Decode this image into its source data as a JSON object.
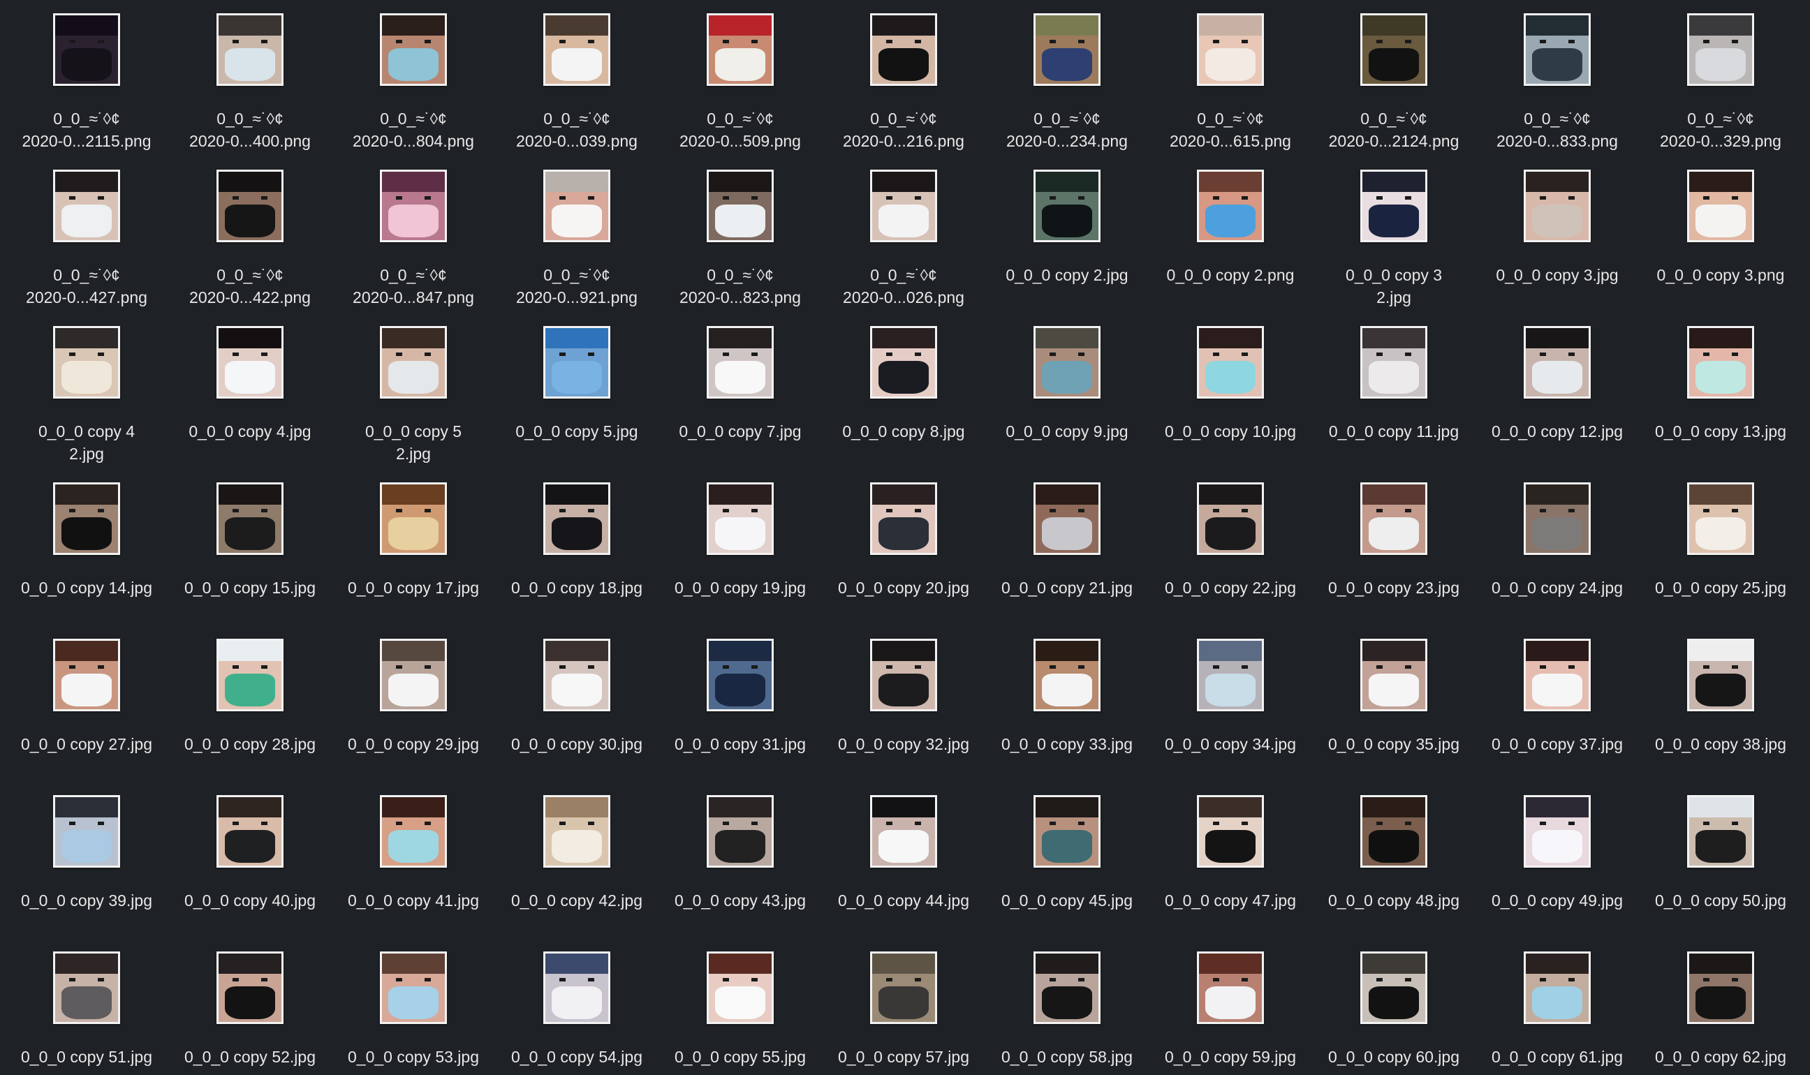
{
  "files": [
    {
      "name": "0_0_≈˙◊¢\n2020-0...2115.png",
      "skin": "#2b2230",
      "hair": "#120d18",
      "mask": "#15121a"
    },
    {
      "name": "0_0_≈˙◊¢\n2020-0...400.png",
      "skin": "#c9b7aa",
      "hair": "#3a3533",
      "mask": "#d9e3ea"
    },
    {
      "name": "0_0_≈˙◊¢\n2020-0...804.png",
      "skin": "#b88670",
      "hair": "#2a1f1b",
      "mask": "#8fc3d6"
    },
    {
      "name": "0_0_≈˙◊¢\n2020-0...039.png",
      "skin": "#d8b9a0",
      "hair": "#4a3b31",
      "mask": "#f4f4f4"
    },
    {
      "name": "0_0_≈˙◊¢\n2020-0...509.png",
      "skin": "#c98a72",
      "hair": "#b8242a",
      "mask": "#f0efe9"
    },
    {
      "name": "0_0_≈˙◊¢\n2020-0...216.png",
      "skin": "#d3b6a4",
      "hair": "#1e1a1b",
      "mask": "#121212"
    },
    {
      "name": "0_0_≈˙◊¢\n2020-0...234.png",
      "skin": "#9c7b5c",
      "hair": "#7b7b52",
      "mask": "#2e3f72"
    },
    {
      "name": "0_0_≈˙◊¢\n2020-0...615.png",
      "skin": "#e8c7b6",
      "hair": "#c8b1a4",
      "mask": "#f3eae4"
    },
    {
      "name": "0_0_≈˙◊¢\n2020-0...2124.png",
      "skin": "#6a5a3e",
      "hair": "#3e3a26",
      "mask": "#121212"
    },
    {
      "name": "0_0_≈˙◊¢\n2020-0...833.png",
      "skin": "#9aa8b2",
      "hair": "#222c33",
      "mask": "#2f3b45"
    },
    {
      "name": "0_0_≈˙◊¢\n2020-0...329.png",
      "skin": "#b9b6b5",
      "hair": "#3a3a3c",
      "mask": "#d8dadd"
    },
    {
      "name": "0_0_≈˙◊¢\n2020-0...427.png",
      "skin": "#d8c2b6",
      "hair": "#201b1c",
      "mask": "#eef0f2"
    },
    {
      "name": "0_0_≈˙◊¢\n2020-0...422.png",
      "skin": "#8c6e5e",
      "hair": "#141212",
      "mask": "#161616"
    },
    {
      "name": "0_0_≈˙◊¢\n2020-0...847.png",
      "skin": "#b9788e",
      "hair": "#5e2d46",
      "mask": "#f1c4d6"
    },
    {
      "name": "0_0_≈˙◊¢\n2020-0...921.png",
      "skin": "#d8a89a",
      "hair": "#b8b0aa",
      "mask": "#f7f5f3"
    },
    {
      "name": "0_0_≈˙◊¢\n2020-0...823.png",
      "skin": "#7f6a60",
      "hair": "#1a1716",
      "mask": "#eceff1"
    },
    {
      "name": "0_0_≈˙◊¢\n2020-0...026.png",
      "skin": "#d7c2b8",
      "hair": "#1b1718",
      "mask": "#f3f3f3"
    },
    {
      "name": "0_0_0 copy 2.jpg",
      "skin": "#5d7569",
      "hair": "#1b2a24",
      "mask": "#0f1516"
    },
    {
      "name": "0_0_0 copy 2.png",
      "skin": "#d79884",
      "hair": "#6b3e33",
      "mask": "#4da0dd"
    },
    {
      "name": "0_0_0 copy 3\n2.jpg",
      "skin": "#e8dde0",
      "hair": "#1e2230",
      "mask": "#1a2440"
    },
    {
      "name": "0_0_0 copy 3.jpg",
      "skin": "#d8b8aa",
      "hair": "#2a2220",
      "mask": "#cfc2b8"
    },
    {
      "name": "0_0_0 copy 3.png",
      "skin": "#e1b8a2",
      "hair": "#2a1c18",
      "mask": "#f5f3f2"
    },
    {
      "name": "0_0_0 copy 4\n2.jpg",
      "skin": "#d9c6b4",
      "hair": "#2e2a2a",
      "mask": "#efe7da"
    },
    {
      "name": "0_0_0 copy 4.jpg",
      "skin": "#e3cdc7",
      "hair": "#141012",
      "mask": "#f4f6f8"
    },
    {
      "name": "0_0_0 copy 5\n2.jpg",
      "skin": "#d6b7a6",
      "hair": "#3a2b25",
      "mask": "#e5e8ea"
    },
    {
      "name": "0_0_0 copy 5.jpg",
      "skin": "#6ea2d3",
      "hair": "#2f74ba",
      "mask": "#79b3e3"
    },
    {
      "name": "0_0_0 copy 7.jpg",
      "skin": "#d0c5c5",
      "hair": "#242020",
      "mask": "#f8f8f8"
    },
    {
      "name": "0_0_0 copy 8.jpg",
      "skin": "#e5cdc6",
      "hair": "#2a1f21",
      "mask": "#1b1c22"
    },
    {
      "name": "0_0_0 copy 9.jpg",
      "skin": "#a98c7b",
      "hair": "#4d4a42",
      "mask": "#6fa2b5"
    },
    {
      "name": "0_0_0 copy 10.jpg",
      "skin": "#e2c1b5",
      "hair": "#2a1d1c",
      "mask": "#8ed7e0"
    },
    {
      "name": "0_0_0 copy 11.jpg",
      "skin": "#c8c2c4",
      "hair": "#3a3436",
      "mask": "#eceaea"
    },
    {
      "name": "0_0_0 copy 12.jpg",
      "skin": "#c8b4ad",
      "hair": "#191617",
      "mask": "#e6eaec"
    },
    {
      "name": "0_0_0 copy 13.jpg",
      "skin": "#e3b7aa",
      "hair": "#271a18",
      "mask": "#bfe8e2"
    },
    {
      "name": "0_0_0 copy 14.jpg",
      "skin": "#9c8270",
      "hair": "#2b2320",
      "mask": "#111111"
    },
    {
      "name": "0_0_0 copy 15.jpg",
      "skin": "#8f7b6a",
      "hair": "#1a1615",
      "mask": "#1c1c1c"
    },
    {
      "name": "0_0_0 copy 17.jpg",
      "skin": "#cf9a72",
      "hair": "#6a3e20",
      "mask": "#e8cfa0"
    },
    {
      "name": "0_0_0 copy 18.jpg",
      "skin": "#c6b0a6",
      "hair": "#141416",
      "mask": "#15151a"
    },
    {
      "name": "0_0_0 copy 19.jpg",
      "skin": "#e2d0cd",
      "hair": "#2a1e1e",
      "mask": "#f6f6f8"
    },
    {
      "name": "0_0_0 copy 20.jpg",
      "skin": "#e0c6bd",
      "hair": "#2b2021",
      "mask": "#2a2f38"
    },
    {
      "name": "0_0_0 copy 21.jpg",
      "skin": "#8f6a5a",
      "hair": "#2a1c18",
      "mask": "#c8c8cc"
    },
    {
      "name": "0_0_0 copy 22.jpg",
      "skin": "#c5a99b",
      "hair": "#1a1818",
      "mask": "#1b1b1d"
    },
    {
      "name": "0_0_0 copy 23.jpg",
      "skin": "#c39a8c",
      "hair": "#5a3a33",
      "mask": "#eeeeee"
    },
    {
      "name": "0_0_0 copy 24.jpg",
      "skin": "#8a7468",
      "hair": "#2a2421",
      "mask": "#7d7b7a"
    },
    {
      "name": "0_0_0 copy 25.jpg",
      "skin": "#ddc2ae",
      "hair": "#5b4436",
      "mask": "#f4eee8"
    },
    {
      "name": "0_0_0 copy 27.jpg",
      "skin": "#c8967e",
      "hair": "#4a2a20",
      "mask": "#f5f5f5"
    },
    {
      "name": "0_0_0 copy 28.jpg",
      "skin": "#e2c3b3",
      "hair": "#e9eef0",
      "mask": "#3fb08b"
    },
    {
      "name": "0_0_0 copy 29.jpg",
      "skin": "#b9a49a",
      "hair": "#57483f",
      "mask": "#f4f4f4"
    },
    {
      "name": "0_0_0 copy 30.jpg",
      "skin": "#d6c5bf",
      "hair": "#3a302e",
      "mask": "#f7f7f7"
    },
    {
      "name": "0_0_0 copy 31.jpg",
      "skin": "#4f6a8e",
      "hair": "#1d2a44",
      "mask": "#1a2742"
    },
    {
      "name": "0_0_0 copy 32.jpg",
      "skin": "#cfb7ad",
      "hair": "#1a1718",
      "mask": "#1c1c1e"
    },
    {
      "name": "0_0_0 copy 33.jpg",
      "skin": "#b88a6e",
      "hair": "#2a1d16",
      "mask": "#f4f4f4"
    },
    {
      "name": "0_0_0 copy 34.jpg",
      "skin": "#b6b2b8",
      "hair": "#5c6b84",
      "mask": "#c8dde8"
    },
    {
      "name": "0_0_0 copy 35.jpg",
      "skin": "#c2a196",
      "hair": "#2b2324",
      "mask": "#f5f5f5"
    },
    {
      "name": "0_0_0 copy 37.jpg",
      "skin": "#e5bdb0",
      "hair": "#2a1a1a",
      "mask": "#f6f6f6"
    },
    {
      "name": "0_0_0 copy 38.jpg",
      "skin": "#c8b5ad",
      "hair": "#eeeeee",
      "mask": "#161616"
    },
    {
      "name": "0_0_0 copy 39.jpg",
      "skin": "#b8c1cf",
      "hair": "#2b2f38",
      "mask": "#aac9e3"
    },
    {
      "name": "0_0_0 copy 40.jpg",
      "skin": "#d8bba8",
      "hair": "#2e2420",
      "mask": "#1f2022"
    },
    {
      "name": "0_0_0 copy 41.jpg",
      "skin": "#d79f86",
      "hair": "#3a1f18",
      "mask": "#9ed7e2"
    },
    {
      "name": "0_0_0 copy 42.jpg",
      "skin": "#d9c5ae",
      "hair": "#9a8064",
      "mask": "#f2ece2"
    },
    {
      "name": "0_0_0 copy 43.jpg",
      "skin": "#b8a8a0",
      "hair": "#2a2424",
      "mask": "#222222"
    },
    {
      "name": "0_0_0 copy 44.jpg",
      "skin": "#c9b3ac",
      "hair": "#121214",
      "mask": "#f7f7f7"
    },
    {
      "name": "0_0_0 copy 45.jpg",
      "skin": "#b7917d",
      "hair": "#201a18",
      "mask": "#3f6b72"
    },
    {
      "name": "0_0_0 copy 47.jpg",
      "skin": "#e5d2c6",
      "hair": "#3b2e28",
      "mask": "#141414"
    },
    {
      "name": "0_0_0 copy 48.jpg",
      "skin": "#7b5e4e",
      "hair": "#2a1d18",
      "mask": "#101010"
    },
    {
      "name": "0_0_0 copy 49.jpg",
      "skin": "#e8d9df",
      "hair": "#2c2834",
      "mask": "#f7f6fa"
    },
    {
      "name": "0_0_0 copy 50.jpg",
      "skin": "#cbbcae",
      "hair": "#dfe4e8",
      "mask": "#1e1e1e"
    },
    {
      "name": "0_0_0 copy 51.jpg",
      "skin": "#c7b2a8",
      "hair": "#2e2626",
      "mask": "#5e5c5e"
    },
    {
      "name": "0_0_0 copy 52.jpg",
      "skin": "#c9a494",
      "hair": "#252021",
      "mask": "#131313"
    },
    {
      "name": "0_0_0 copy 53.jpg",
      "skin": "#d8a898",
      "hair": "#5e4034",
      "mask": "#a6d1e8"
    },
    {
      "name": "0_0_0 copy 54.jpg",
      "skin": "#c8c3cd",
      "hair": "#3c4a6e",
      "mask": "#f1f1f4"
    },
    {
      "name": "0_0_0 copy 55.jpg",
      "skin": "#e8ccc4",
      "hair": "#5a2a22",
      "mask": "#f9f9f9"
    },
    {
      "name": "0_0_0 copy 57.jpg",
      "skin": "#9a8a76",
      "hair": "#5e5446",
      "mask": "#3a3836"
    },
    {
      "name": "0_0_0 copy 58.jpg",
      "skin": "#b8a49a",
      "hair": "#201c1c",
      "mask": "#161616"
    },
    {
      "name": "0_0_0 copy 59.jpg",
      "skin": "#b88070",
      "hair": "#5e2e24",
      "mask": "#f2f2f4"
    },
    {
      "name": "0_0_0 copy 60.jpg",
      "skin": "#c8c0b8",
      "hair": "#3e3a36",
      "mask": "#121212"
    },
    {
      "name": "0_0_0 copy 61.jpg",
      "skin": "#c2ac9e",
      "hair": "#2a2220",
      "mask": "#9fd0e6"
    },
    {
      "name": "0_0_0 copy 62.jpg",
      "skin": "#8f7668",
      "hair": "#1c1818",
      "mask": "#141414"
    }
  ]
}
